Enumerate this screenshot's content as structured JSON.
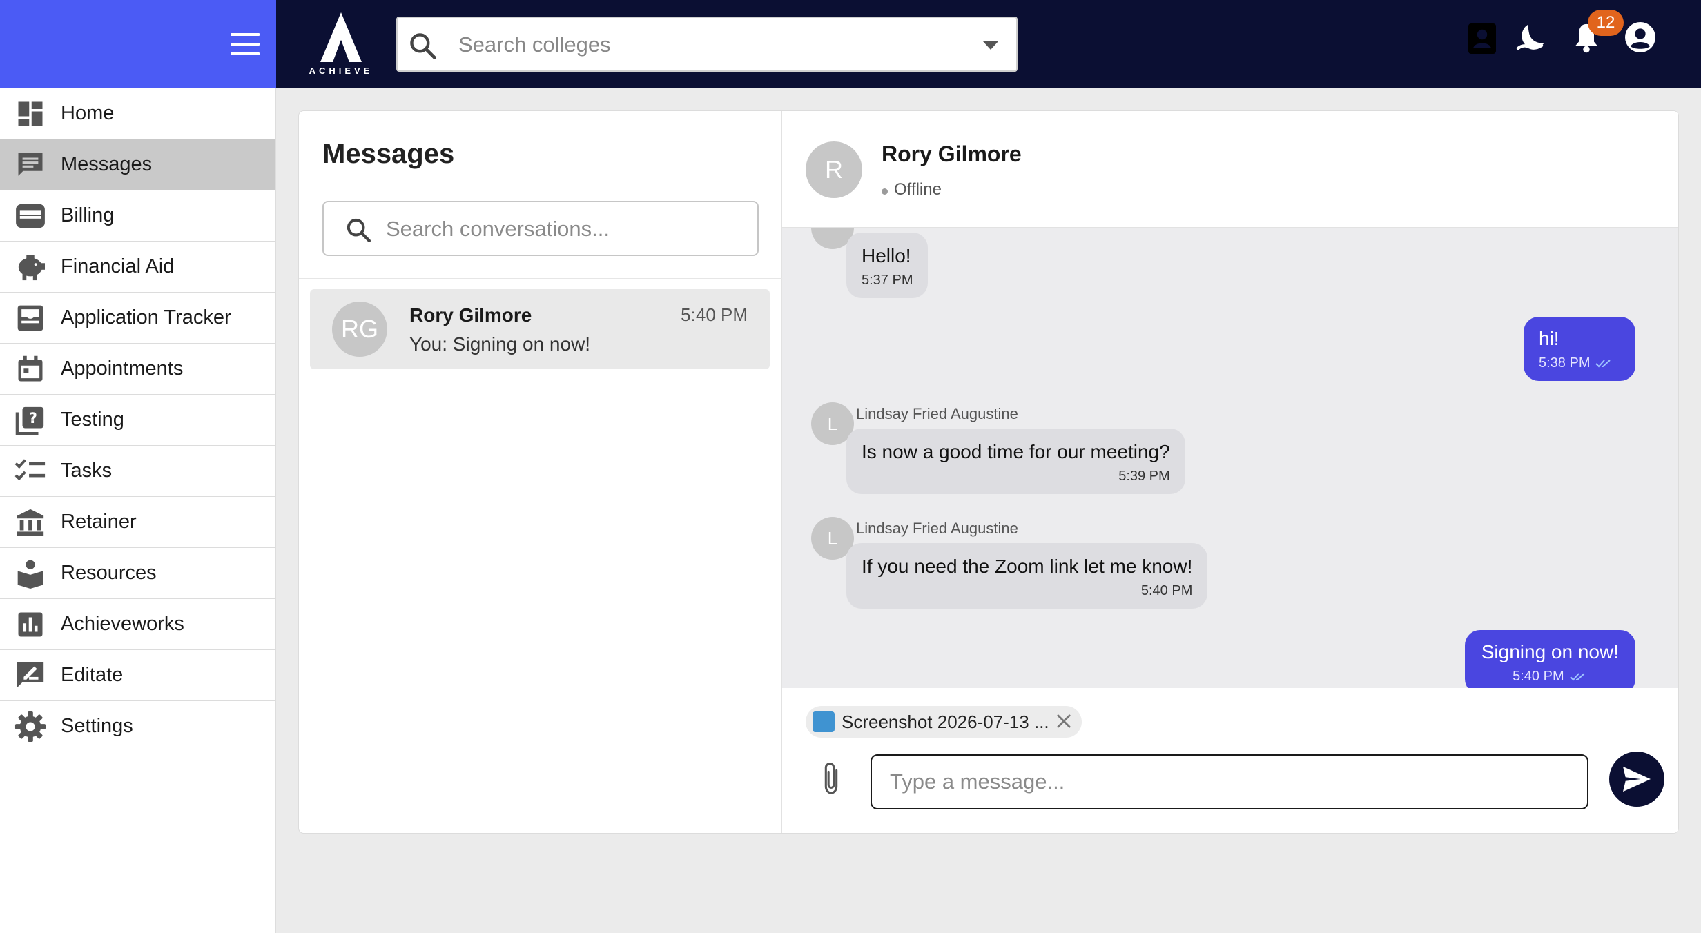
{
  "app": {
    "logo_text": "ACHIEVE"
  },
  "topbar": {
    "search_placeholder": "Search colleges",
    "notification_count": "12",
    "icons": [
      "contacts-icon",
      "dark-mode-icon",
      "bell-icon",
      "account-icon"
    ]
  },
  "sidebar": {
    "items": [
      {
        "label": "Home",
        "icon": "dashboard-icon"
      },
      {
        "label": "Messages",
        "icon": "chat-icon",
        "active": true
      },
      {
        "label": "Billing",
        "icon": "wallet-icon"
      },
      {
        "label": "Financial Aid",
        "icon": "piggy-bank-icon"
      },
      {
        "label": "Application Tracker",
        "icon": "inbox-tray-icon"
      },
      {
        "label": "Appointments",
        "icon": "calendar-icon"
      },
      {
        "label": "Testing",
        "icon": "quiz-icon"
      },
      {
        "label": "Tasks",
        "icon": "checklist-icon"
      },
      {
        "label": "Retainer",
        "icon": "bank-icon"
      },
      {
        "label": "Resources",
        "icon": "book-reader-icon"
      },
      {
        "label": "Achieveworks",
        "icon": "bar-chart-icon"
      },
      {
        "label": "Editate",
        "icon": "edit-note-icon"
      },
      {
        "label": "Settings",
        "icon": "gear-icon"
      }
    ]
  },
  "conversations": {
    "title": "Messages",
    "search_placeholder": "Search conversations...",
    "items": [
      {
        "initials": "RG",
        "name": "Rory Gilmore",
        "time": "5:40 PM",
        "preview": "You: Signing on now!"
      }
    ]
  },
  "chat": {
    "contact_initial": "R",
    "contact_name": "Rory Gilmore",
    "status": "Offline",
    "messages": [
      {
        "direction": "in",
        "text": "Hello!",
        "time": "5:37 PM"
      },
      {
        "direction": "out",
        "text": "hi!",
        "time": "5:38 PM"
      },
      {
        "direction": "in",
        "avatar": "L",
        "sender": "Lindsay Fried Augustine",
        "text": "Is now a good time for our meeting?",
        "time": "5:39 PM"
      },
      {
        "direction": "in",
        "avatar": "L",
        "sender": "Lindsay Fried Augustine",
        "text": "If you need the Zoom link let me know!",
        "time": "5:40 PM"
      },
      {
        "direction": "out",
        "text": "Signing on now!",
        "time": "5:40 PM"
      }
    ],
    "attachment_name": "Screenshot 2026-07-13 ...",
    "input_placeholder": "Type a message..."
  },
  "colors": {
    "sidebar_header": "#4b5bf5",
    "topbar": "#0b0f33",
    "outgoing_bubble": "#4a46e0",
    "incoming_bubble": "#dddde1",
    "badge": "#e1641d"
  }
}
